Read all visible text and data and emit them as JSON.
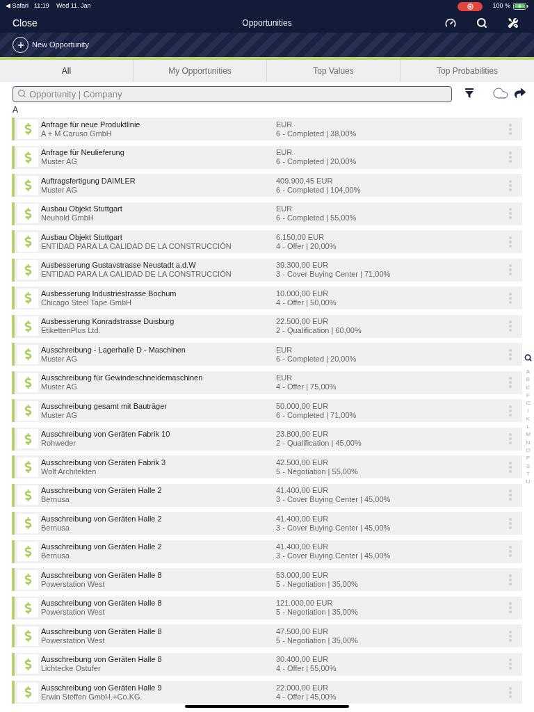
{
  "status_bar": {
    "back_label": "◀ Safari",
    "time": "11:19",
    "date": "Wed 11. Jan",
    "battery": "100 %"
  },
  "nav_bar": {
    "close": "Close",
    "title": "Opportunities"
  },
  "new_button": {
    "label": "New Opportunity"
  },
  "tabs": [
    {
      "label": "All",
      "selected": true
    },
    {
      "label": "My Opportunities",
      "selected": false
    },
    {
      "label": "Top Values",
      "selected": false
    },
    {
      "label": "Top Probabilities",
      "selected": false
    }
  ],
  "search": {
    "placeholder": "Opportunity | Company"
  },
  "section": {
    "letter": "A"
  },
  "opportunities": [
    {
      "title": "Anfrage für neue Produktlinie",
      "company": "A + M Caruso GmbH",
      "value": "EUR",
      "stage": "6 - Completed | 38,00%"
    },
    {
      "title": "Anfrage für Neulieferung",
      "company": "Muster AG",
      "value": "EUR",
      "stage": "6 - Completed | 20,00%"
    },
    {
      "title": "Auftragsfertigung DAIMLER",
      "company": "Muster AG",
      "value": "409.900,45 EUR",
      "stage": "6 - Completed | 104,00%"
    },
    {
      "title": "Ausbau Objekt Stuttgart",
      "company": "Neuhold GmbH",
      "value": "EUR",
      "stage": "6 - Completed | 55,00%"
    },
    {
      "title": "Ausbau Objekt Stuttgart",
      "company": "ENTIDAD PARA LA CALIDAD DE LA CONSTRUCCIÓN",
      "value": "6.150,00 EUR",
      "stage": "4 - Offer | 20,00%"
    },
    {
      "title": "Ausbesserung Gustavstrasse Neustadt a.d.W",
      "company": "ENTIDAD PARA LA CALIDAD DE LA CONSTRUCCIÓN",
      "value": "39.300,00 EUR",
      "stage": "3 - Cover Buying Center | 71,00%"
    },
    {
      "title": "Ausbesserung Industriestrasse Bochum",
      "company": "Chicago Steel Tape GmbH",
      "value": "10.000,00 EUR",
      "stage": "4 - Offer | 50,00%"
    },
    {
      "title": "Ausbesserung Konradstrasse Duisburg",
      "company": "EtikettenPlus Ltd.",
      "value": "22.500,00 EUR",
      "stage": "2 - Qualification | 60,00%"
    },
    {
      "title": "Ausschreibung - Lagerhalle D - Maschinen",
      "company": "Muster AG",
      "value": "EUR",
      "stage": "6 - Completed | 20,00%"
    },
    {
      "title": "Ausschreibung für Gewindeschneidemaschinen",
      "company": "Muster AG",
      "value": "EUR",
      "stage": "4 - Offer | 75,00%"
    },
    {
      "title": "Ausschreibung gesamt mit Bauträger",
      "company": "Muster AG",
      "value": "50.000,00 EUR",
      "stage": "6 - Completed | 71,00%"
    },
    {
      "title": "Ausschreibung von Geräten Fabrik 10",
      "company": "Rohweder",
      "value": "23.800,00 EUR",
      "stage": "2 - Qualification | 45,00%"
    },
    {
      "title": "Ausschreibung von Geräten Fabrik 3",
      "company": "Wolf Architekten",
      "value": "42.500,00 EUR",
      "stage": "5 - Negotiation | 55,00%"
    },
    {
      "title": "Ausschreibung von Geräten Halle 2",
      "company": "Bernusa",
      "value": "41.400,00 EUR",
      "stage": "3 - Cover Buying Center | 45,00%"
    },
    {
      "title": "Ausschreibung von Geräten Halle 2",
      "company": "Bernusa",
      "value": "41.400,00 EUR",
      "stage": "3 - Cover Buying Center | 45,00%"
    },
    {
      "title": "Ausschreibung von Geräten Halle 2",
      "company": "Bernusa",
      "value": "41.400,00 EUR",
      "stage": "3 - Cover Buying Center | 45,00%"
    },
    {
      "title": "Ausschreibung von Geräten Halle 8",
      "company": "Powerstation West",
      "value": "53.000,00 EUR",
      "stage": "5 - Negotiation | 35,00%"
    },
    {
      "title": "Ausschreibung von Geräten Halle 8",
      "company": "Powerstation West",
      "value": "121.000,00 EUR",
      "stage": "5 - Negotiation | 35,00%"
    },
    {
      "title": "Ausschreibung von Geräten Halle 8",
      "company": "Powerstation West",
      "value": "47.500,00 EUR",
      "stage": "5 - Negotiation | 35,00%"
    },
    {
      "title": "Ausschreibung von Geräten Halle 8",
      "company": "Lichtecke Ostufer",
      "value": "30.400,00 EUR",
      "stage": "4 - Offer | 55,00%"
    },
    {
      "title": "Ausschreibung von Geräten Halle 9",
      "company": "Erwin Steffen GmbH.+Co.KG.",
      "value": "22.000,00 EUR",
      "stage": "4 - Offer | 45,00%"
    }
  ],
  "alpha_index": [
    "A",
    "B",
    "E",
    "F",
    "G",
    "I",
    "K",
    "L",
    "M",
    "N",
    "O",
    "P",
    "S",
    "T",
    "U"
  ]
}
